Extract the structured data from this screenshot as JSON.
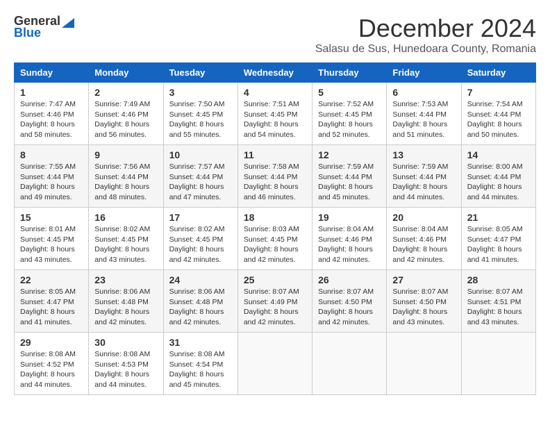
{
  "header": {
    "logo_general": "General",
    "logo_blue": "Blue",
    "month_title": "December 2024",
    "location": "Salasu de Sus, Hunedoara County, Romania"
  },
  "weekdays": [
    "Sunday",
    "Monday",
    "Tuesday",
    "Wednesday",
    "Thursday",
    "Friday",
    "Saturday"
  ],
  "weeks": [
    [
      {
        "day": "1",
        "sunrise": "7:47 AM",
        "sunset": "4:46 PM",
        "daylight": "8 hours and 58 minutes."
      },
      {
        "day": "2",
        "sunrise": "7:49 AM",
        "sunset": "4:46 PM",
        "daylight": "8 hours and 56 minutes."
      },
      {
        "day": "3",
        "sunrise": "7:50 AM",
        "sunset": "4:45 PM",
        "daylight": "8 hours and 55 minutes."
      },
      {
        "day": "4",
        "sunrise": "7:51 AM",
        "sunset": "4:45 PM",
        "daylight": "8 hours and 54 minutes."
      },
      {
        "day": "5",
        "sunrise": "7:52 AM",
        "sunset": "4:45 PM",
        "daylight": "8 hours and 52 minutes."
      },
      {
        "day": "6",
        "sunrise": "7:53 AM",
        "sunset": "4:44 PM",
        "daylight": "8 hours and 51 minutes."
      },
      {
        "day": "7",
        "sunrise": "7:54 AM",
        "sunset": "4:44 PM",
        "daylight": "8 hours and 50 minutes."
      }
    ],
    [
      {
        "day": "8",
        "sunrise": "7:55 AM",
        "sunset": "4:44 PM",
        "daylight": "8 hours and 49 minutes."
      },
      {
        "day": "9",
        "sunrise": "7:56 AM",
        "sunset": "4:44 PM",
        "daylight": "8 hours and 48 minutes."
      },
      {
        "day": "10",
        "sunrise": "7:57 AM",
        "sunset": "4:44 PM",
        "daylight": "8 hours and 47 minutes."
      },
      {
        "day": "11",
        "sunrise": "7:58 AM",
        "sunset": "4:44 PM",
        "daylight": "8 hours and 46 minutes."
      },
      {
        "day": "12",
        "sunrise": "7:59 AM",
        "sunset": "4:44 PM",
        "daylight": "8 hours and 45 minutes."
      },
      {
        "day": "13",
        "sunrise": "7:59 AM",
        "sunset": "4:44 PM",
        "daylight": "8 hours and 44 minutes."
      },
      {
        "day": "14",
        "sunrise": "8:00 AM",
        "sunset": "4:44 PM",
        "daylight": "8 hours and 44 minutes."
      }
    ],
    [
      {
        "day": "15",
        "sunrise": "8:01 AM",
        "sunset": "4:45 PM",
        "daylight": "8 hours and 43 minutes."
      },
      {
        "day": "16",
        "sunrise": "8:02 AM",
        "sunset": "4:45 PM",
        "daylight": "8 hours and 43 minutes."
      },
      {
        "day": "17",
        "sunrise": "8:02 AM",
        "sunset": "4:45 PM",
        "daylight": "8 hours and 42 minutes."
      },
      {
        "day": "18",
        "sunrise": "8:03 AM",
        "sunset": "4:45 PM",
        "daylight": "8 hours and 42 minutes."
      },
      {
        "day": "19",
        "sunrise": "8:04 AM",
        "sunset": "4:46 PM",
        "daylight": "8 hours and 42 minutes."
      },
      {
        "day": "20",
        "sunrise": "8:04 AM",
        "sunset": "4:46 PM",
        "daylight": "8 hours and 42 minutes."
      },
      {
        "day": "21",
        "sunrise": "8:05 AM",
        "sunset": "4:47 PM",
        "daylight": "8 hours and 41 minutes."
      }
    ],
    [
      {
        "day": "22",
        "sunrise": "8:05 AM",
        "sunset": "4:47 PM",
        "daylight": "8 hours and 41 minutes."
      },
      {
        "day": "23",
        "sunrise": "8:06 AM",
        "sunset": "4:48 PM",
        "daylight": "8 hours and 42 minutes."
      },
      {
        "day": "24",
        "sunrise": "8:06 AM",
        "sunset": "4:48 PM",
        "daylight": "8 hours and 42 minutes."
      },
      {
        "day": "25",
        "sunrise": "8:07 AM",
        "sunset": "4:49 PM",
        "daylight": "8 hours and 42 minutes."
      },
      {
        "day": "26",
        "sunrise": "8:07 AM",
        "sunset": "4:50 PM",
        "daylight": "8 hours and 42 minutes."
      },
      {
        "day": "27",
        "sunrise": "8:07 AM",
        "sunset": "4:50 PM",
        "daylight": "8 hours and 43 minutes."
      },
      {
        "day": "28",
        "sunrise": "8:07 AM",
        "sunset": "4:51 PM",
        "daylight": "8 hours and 43 minutes."
      }
    ],
    [
      {
        "day": "29",
        "sunrise": "8:08 AM",
        "sunset": "4:52 PM",
        "daylight": "8 hours and 44 minutes."
      },
      {
        "day": "30",
        "sunrise": "8:08 AM",
        "sunset": "4:53 PM",
        "daylight": "8 hours and 44 minutes."
      },
      {
        "day": "31",
        "sunrise": "8:08 AM",
        "sunset": "4:54 PM",
        "daylight": "8 hours and 45 minutes."
      },
      null,
      null,
      null,
      null
    ]
  ]
}
